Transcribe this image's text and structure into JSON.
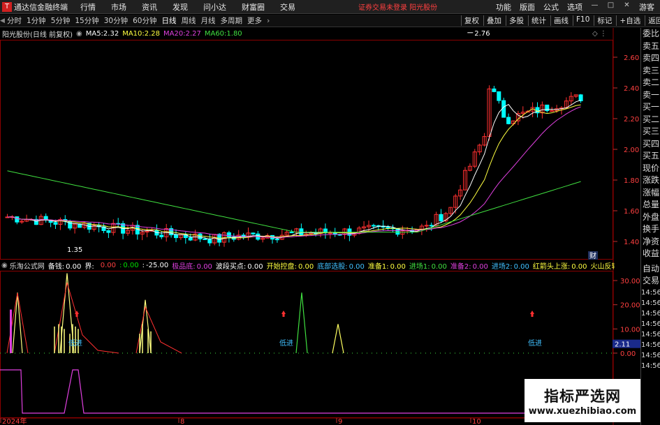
{
  "menubar": {
    "app_title": "通达信金融终端",
    "items": [
      "行情",
      "市场",
      "资讯",
      "发现",
      "问小达",
      "财富圈",
      "交易"
    ],
    "alert": "证券交易未登录  阳光股份",
    "right_items": [
      "功能",
      "版面",
      "公式",
      "选项"
    ],
    "user": "游客"
  },
  "periodbar": {
    "periods": [
      "分时",
      "1分钟",
      "5分钟",
      "15分钟",
      "30分钟",
      "60分钟",
      "日线",
      "周线",
      "月线",
      "多周期",
      "更多"
    ],
    "active": "日线",
    "tools": [
      "复权",
      "叠加",
      "多股",
      "统计",
      "画线",
      "F10",
      "标记",
      "+自选",
      "返回"
    ]
  },
  "ma": {
    "stock_label": "阳光股份(日线 前复权)",
    "ma5_label": "MA5:",
    "ma5": "2.32",
    "ma10_label": "MA10:",
    "ma10": "2.28",
    "ma20_label": "MA20:",
    "ma20": "2.27",
    "ma60_label": "MA60:",
    "ma60": "1.80"
  },
  "price_axis": {
    "ticks": [
      "2.60",
      "2.40",
      "2.20",
      "2.00",
      "1.80",
      "1.60",
      "1.40"
    ]
  },
  "annotations": {
    "high": "2.76",
    "low": "1.35",
    "fin_badge": "财"
  },
  "indicator": {
    "name": "乐淘公式网",
    "items": [
      {
        "label": "备钱:",
        "value": "0.00",
        "color": "#ffffff"
      },
      {
        "label": "界:",
        "value": "",
        "color": "#ffffff"
      },
      {
        "label": "",
        "value": "0.00",
        "color": "#ff4040"
      },
      {
        "label": ":",
        "value": "0.00",
        "color": "#00e000"
      },
      {
        "label": ":",
        "value": "-25.00",
        "color": "#ffffff"
      },
      {
        "label": "极品底:",
        "value": "0.00",
        "color": "#e040e0"
      },
      {
        "label": "波段买点:",
        "value": "0.00",
        "color": "#ffffff"
      },
      {
        "label": "开始控盘:",
        "value": "0.00",
        "color": "#ffff40"
      },
      {
        "label": "底部选股:",
        "value": "0.00",
        "color": "#40c0ff"
      },
      {
        "label": "准备1:",
        "value": "0.00",
        "color": "#ffff40"
      },
      {
        "label": "进场1:",
        "value": "0.00",
        "color": "#40e040"
      },
      {
        "label": "准备2:",
        "value": "0.00",
        "color": "#e040e0"
      },
      {
        "label": "进场2:",
        "value": "0.00",
        "color": "#40c0ff"
      },
      {
        "label": "红箭头上涨:",
        "value": "0.00",
        "color": "#ffff40"
      },
      {
        "label": "火山反转底部:",
        "value": "0.00",
        "color": "#ffff40"
      },
      {
        "label": "波",
        "value": "",
        "color": "#ff4040"
      }
    ],
    "axis_ticks": [
      "30.00",
      "20.00",
      "10.00",
      "0.00"
    ],
    "current_value": "2.11",
    "signal_label": "低进"
  },
  "date_axis": {
    "labels": [
      "2024年",
      "8",
      "9",
      "10"
    ]
  },
  "rightpanel": {
    "items": [
      "委比",
      "卖五",
      "卖四",
      "卖三",
      "卖二",
      "卖一",
      "买一",
      "买二",
      "买三",
      "买四",
      "买五",
      "现价",
      "涨跌",
      "涨幅",
      "总量",
      "外盘",
      "换手",
      "净资",
      "收益"
    ],
    "items2": [
      "自动",
      "交易"
    ],
    "times": [
      "14:56",
      "14:56",
      "14:56",
      "14:56",
      "14:56",
      "14:56",
      "14:56",
      "14:56"
    ]
  },
  "watermark": {
    "line1": "指标严选网",
    "line2": "www.xuezhibiao.com"
  },
  "colors": {
    "up": "#ff3030",
    "down": "#00ffff",
    "ma5": "#ffffff",
    "ma10": "#ffff40",
    "ma20": "#e040e0",
    "ma60": "#40e040",
    "grid": "#8b0000"
  }
}
